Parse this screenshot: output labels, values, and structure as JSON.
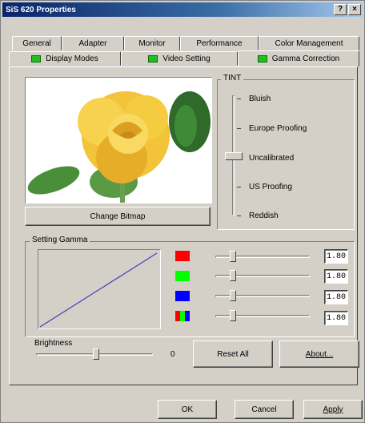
{
  "window": {
    "title": "SiS 620 Properties",
    "help_btn": "?",
    "close_btn": "×"
  },
  "tabs_row1": [
    "General",
    "Adapter",
    "Monitor",
    "Performance",
    "Color Management"
  ],
  "tabs_row2": [
    "Display Modes",
    "Video Setting",
    "Gamma Correction"
  ],
  "active_tab": "Gamma Correction",
  "preview": {
    "button_label": "Change Bitmap"
  },
  "tint": {
    "label": "TINT",
    "options": [
      "Bluish",
      "Europe Proofing",
      "Uncalibrated",
      "US Proofing",
      "Reddish"
    ],
    "selected": "Uncalibrated"
  },
  "setting_gamma": {
    "label": "Setting Gamma",
    "channels": [
      {
        "name": "red",
        "color": "#ff0000",
        "value": "1.80"
      },
      {
        "name": "green",
        "color": "#00ff00",
        "value": "1.80"
      },
      {
        "name": "blue",
        "color": "#0000ff",
        "value": "1.80"
      },
      {
        "name": "all",
        "colors": [
          "#ff0000",
          "#00ff00",
          "#0000ff"
        ],
        "value": "1.80"
      }
    ]
  },
  "brightness": {
    "label": "Brightness",
    "value": "0"
  },
  "buttons": {
    "reset_all": "Reset All",
    "about": "About...",
    "ok": "OK",
    "cancel": "Cancel",
    "apply": "Apply"
  },
  "colors": {
    "titlebar_start": "#0a246a",
    "face": "#d4d0c8",
    "gamma_line": "#4040c0"
  }
}
